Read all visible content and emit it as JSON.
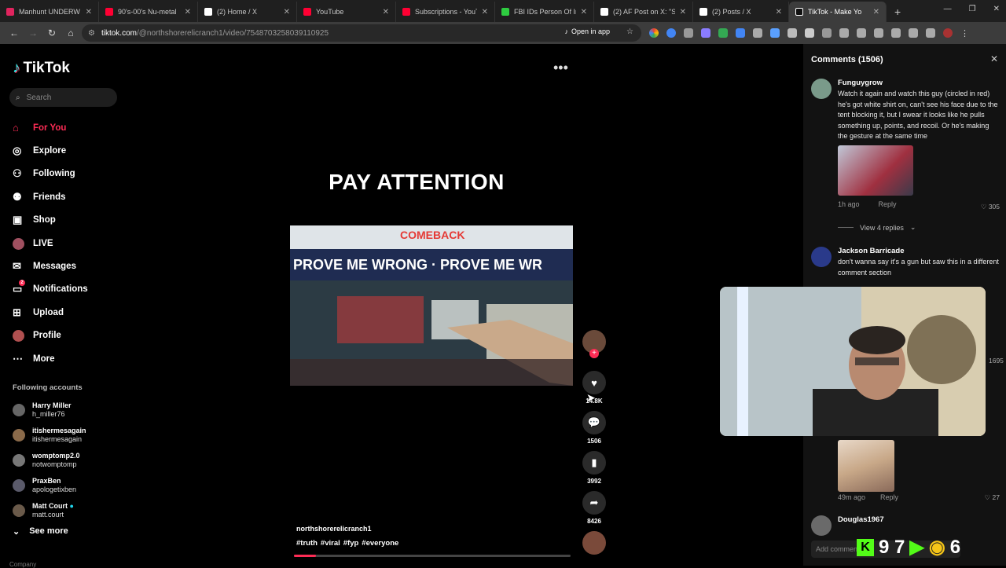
{
  "browser": {
    "tabs": [
      {
        "title": "Manhunt UNDERW",
        "color": "#e0245e"
      },
      {
        "title": "90's-00's Nu-metal",
        "color": "#ff0033"
      },
      {
        "title": "(2) Home / X",
        "color": "#ffffff"
      },
      {
        "title": "YouTube",
        "color": "#ff0033"
      },
      {
        "title": "Subscriptions - YouTu",
        "color": "#ff0033"
      },
      {
        "title": "FBI IDs Person Of Inte",
        "color": "#2ecc40"
      },
      {
        "title": "(2) AF Post on X: \"Ste",
        "color": "#ffffff"
      },
      {
        "title": "(2) Posts / X",
        "color": "#ffffff"
      },
      {
        "title": "TikTok - Make Yo",
        "color": "#ffffff",
        "active": true
      }
    ],
    "url_host": "tiktok.com",
    "url_path": "/@northshorerelicranch1/video/7548703258039110925",
    "open_in_app": "Open in app"
  },
  "sidebar": {
    "brand": "TikTok",
    "search_placeholder": "Search",
    "nav": [
      {
        "label": "For You",
        "icon": "home-icon",
        "active": true
      },
      {
        "label": "Explore",
        "icon": "compass-icon"
      },
      {
        "label": "Following",
        "icon": "following-icon"
      },
      {
        "label": "Friends",
        "icon": "friends-icon"
      },
      {
        "label": "Shop",
        "icon": "shop-icon"
      },
      {
        "label": "LIVE",
        "icon": "live-icon"
      },
      {
        "label": "Messages",
        "icon": "messages-icon"
      },
      {
        "label": "Notifications",
        "icon": "bell-icon",
        "badge": "2"
      },
      {
        "label": "Upload",
        "icon": "upload-icon"
      },
      {
        "label": "Profile",
        "icon": "profile-icon"
      },
      {
        "label": "More",
        "icon": "more-icon"
      }
    ],
    "following_header": "Following accounts",
    "accounts": [
      {
        "name": "Harry Miller",
        "handle": "h_miller76"
      },
      {
        "name": "itishermesagain",
        "handle": "itishermesagain"
      },
      {
        "name": "womptomp2.0",
        "handle": "notwomptomp"
      },
      {
        "name": "PraxBen",
        "handle": "apologetixben"
      },
      {
        "name": "Matt Court",
        "handle": "matt.court",
        "verified": true
      }
    ],
    "see_more": "See more",
    "company": "Company"
  },
  "video": {
    "caption_overlay": "PAY ATTENTION",
    "banner_text": "COMEBACK",
    "tent_text": "PROVE ME WRONG · PROVE ME WR",
    "author": "northshorerelicranch1",
    "tags": [
      "#truth",
      "#viral",
      "#fyp",
      "#everyone"
    ],
    "progress": 0.08,
    "likes": "14.8K",
    "comments": "1506",
    "saves": "3992",
    "shares": "8426"
  },
  "comments": {
    "header": "Comments (1506)",
    "items": [
      {
        "user": "Funguygrow",
        "text": "Watch it again and watch this guy (circled in red) he's got white shirt on, can't see his face due to the tent blocking it, but I swear it looks like he pulls something up, points, and recoil. Or he's making the gesture at the same time",
        "time": "1h ago",
        "reply": "Reply",
        "likes": "305"
      },
      {
        "user": "Jackson Barricade",
        "text": "don't wanna say it's a gun but saw this in a different comment section"
      },
      {
        "user": "Douglas1967"
      }
    ],
    "view_replies": "View 4 replies",
    "second_time": "49m ago",
    "second_reply": "Reply",
    "second_likes": "27",
    "hidden_likes": "1695",
    "add_comment": "Add comment..."
  },
  "overlay": {
    "count": "9 7",
    "trail": "6"
  }
}
